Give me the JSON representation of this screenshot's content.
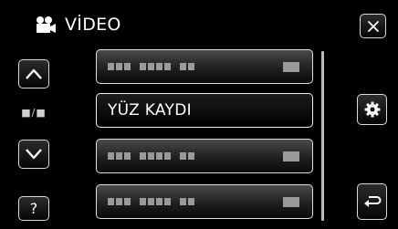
{
  "header": {
    "title": "VİDEO",
    "icon": "video-camera-icon"
  },
  "nav": {
    "page_indicator": "■/■",
    "help_label": "?"
  },
  "menu": {
    "items": [
      {
        "label": ""
      },
      {
        "label": "YÜZ KAYDI",
        "selected": true
      },
      {
        "label": ""
      },
      {
        "label": ""
      }
    ]
  },
  "colors": {
    "background": "#000000",
    "text": "#ffffff",
    "border": "#d8d8d8"
  }
}
